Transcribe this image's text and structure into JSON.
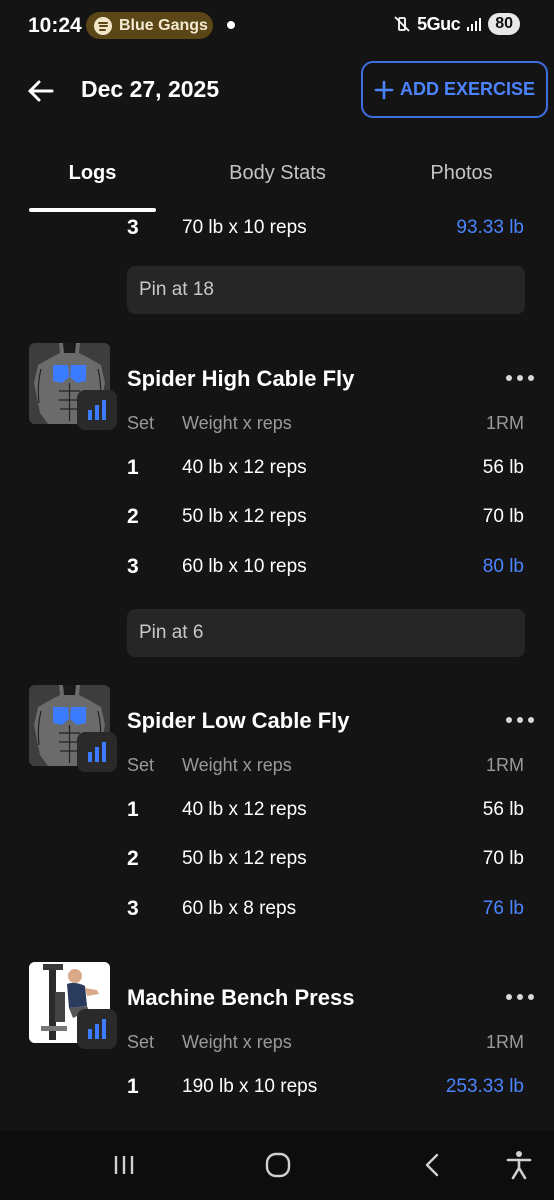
{
  "status_bar": {
    "time": "10:24",
    "spotify_label": "Blue Gangs",
    "network": "5Guc",
    "battery": "80"
  },
  "header": {
    "date": "Dec 27, 2025",
    "add_exercise_label": "ADD EXERCISE"
  },
  "tabs": [
    {
      "label": "Logs",
      "active": true
    },
    {
      "label": "Body Stats",
      "active": false
    },
    {
      "label": "Photos",
      "active": false
    }
  ],
  "columns": {
    "set": "Set",
    "weight": "Weight x reps",
    "rm": "1RM"
  },
  "previous_exercise": {
    "sets": [
      {
        "set": "3",
        "weight_reps": "70 lb x 10 reps",
        "one_rm": "93.33 lb",
        "best": true
      }
    ],
    "note": "Pin at 18"
  },
  "exercises": [
    {
      "name": "Spider High Cable Fly",
      "sets": [
        {
          "set": "1",
          "weight_reps": "40 lb x 12 reps",
          "one_rm": "56 lb",
          "best": false
        },
        {
          "set": "2",
          "weight_reps": "50 lb x 12 reps",
          "one_rm": "70 lb",
          "best": false
        },
        {
          "set": "3",
          "weight_reps": "60 lb x 10 reps",
          "one_rm": "80 lb",
          "best": true
        }
      ],
      "note": "Pin at 6"
    },
    {
      "name": "Spider Low Cable Fly",
      "sets": [
        {
          "set": "1",
          "weight_reps": "40 lb x 12 reps",
          "one_rm": "56 lb",
          "best": false
        },
        {
          "set": "2",
          "weight_reps": "50 lb x 12 reps",
          "one_rm": "70 lb",
          "best": false
        },
        {
          "set": "3",
          "weight_reps": "60 lb x 8 reps",
          "one_rm": "76 lb",
          "best": true
        }
      ]
    },
    {
      "name": "Machine Bench Press",
      "sets": [
        {
          "set": "1",
          "weight_reps": "190 lb x 10 reps",
          "one_rm": "253.33 lb",
          "best": true
        }
      ]
    }
  ],
  "colors": {
    "accent": "#4c84ff",
    "background": "#141414",
    "note_bg": "#262626",
    "muscle_highlight": "#3b7bff"
  },
  "icons": {
    "back": "arrow-left-icon",
    "add": "plus-icon",
    "stats": "bar-chart-icon",
    "more": "more-horizontal-icon",
    "nav": [
      "recent-apps-icon",
      "home-icon",
      "back-icon",
      "accessibility-icon"
    ]
  }
}
